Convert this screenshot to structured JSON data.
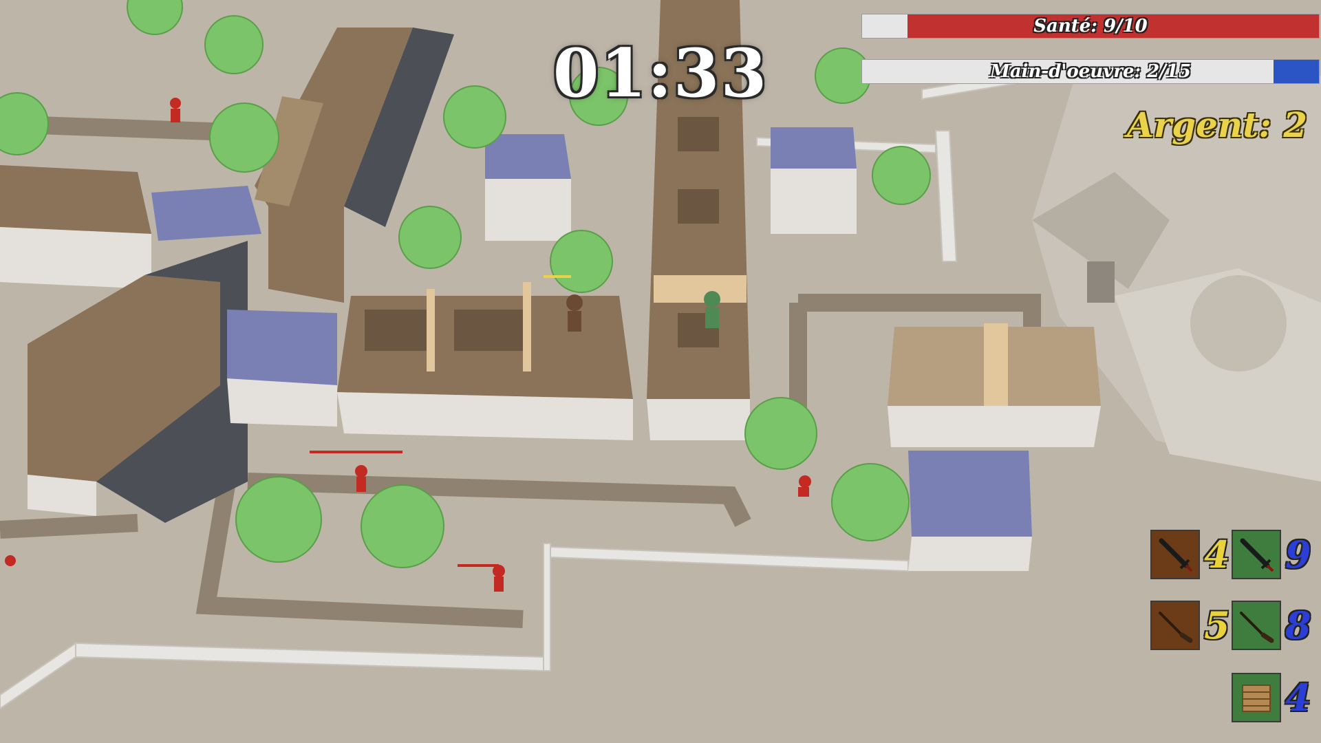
{
  "hud": {
    "timer": "01:33",
    "health_label": "Santé: 9/10",
    "health_value": 9,
    "health_max": 10,
    "workforce_label": "Main-d'oeuvre: 2/15",
    "workforce_value": 2,
    "workforce_max": 15,
    "money_label": "Argent: 2"
  },
  "inventory": [
    {
      "icon": "sword-icon",
      "count": "4",
      "slot_color": "#6b3c17",
      "count_color": "#e9d23c"
    },
    {
      "icon": "sword-icon",
      "count": "9",
      "slot_color": "#3f7d3e",
      "count_color": "#2b3fd6"
    },
    {
      "icon": "musket-icon",
      "count": "5",
      "slot_color": "#6b3c17",
      "count_color": "#e9d23c"
    },
    {
      "icon": "musket-icon",
      "count": "8",
      "slot_color": "#3f7d3e",
      "count_color": "#2b3fd6"
    },
    {
      "icon": "wooden-barricade-icon",
      "count": "4",
      "slot_color": "#3f7d3e",
      "count_color": "#2b3fd6"
    }
  ],
  "colors": {
    "ground": "#bdb5a8",
    "road": "#8f8271",
    "roof_brown": "#8a7358",
    "roof_blue": "#7a80b4",
    "tree": "#7cc46a",
    "wall": "#e8e6e2",
    "health": "#c0312f",
    "workforce": "#2b55c4",
    "money": "#ead34a"
  }
}
